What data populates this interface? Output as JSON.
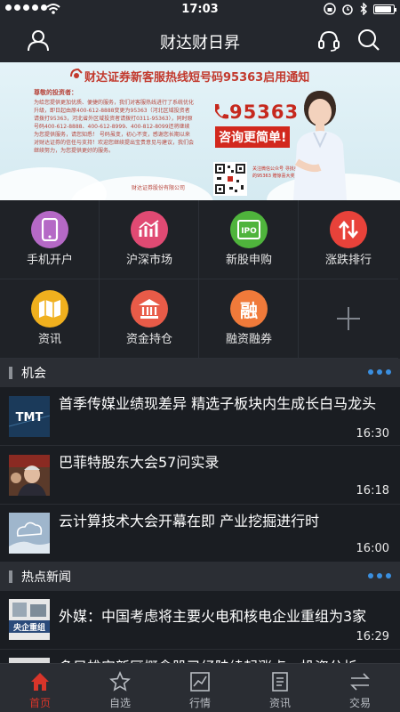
{
  "status_bar": {
    "time": "17:03",
    "battery_level": 0.9
  },
  "header": {
    "title": "财达财日昇"
  },
  "banner": {
    "headline": "财达证券新客服热线短号码95363启用通知",
    "letter_title": "尊敬的投资者：",
    "letter_body": "为给您提供更加优质、便捷的服务，我们对客服热线进行了系统优化升级，即日起由原400-612-8888变更为95363（河北区域投资者请拨打95363，河北省外区域投资者请拨打0311-95363），同时原号码400-612-8888、400-612-8999、400-812-8099还将继续为您提供服务，请您知悉！ 号码虽变，初心不变，感谢您长期以来对财达证券的信任与支持！欢迎您继续提出宝贵意见与建议，我们会继续努力，为您提供更好的服务。",
    "letter_sign": "财达证券股份有限公司",
    "phone": "95363",
    "tagline": "咨询更简单!",
    "qr_text": "关注微信公众号 寻找身边的95363 赠惊喜大奖！"
  },
  "grid": [
    {
      "label": "手机开户",
      "icon": "phone-icon",
      "color": "#b569c6"
    },
    {
      "label": "沪深市场",
      "icon": "market-chart-icon",
      "color": "#e04a73"
    },
    {
      "label": "新股申购",
      "icon": "ipo-icon",
      "color": "#4fb43c"
    },
    {
      "label": "涨跌排行",
      "icon": "up-down-arrows-icon",
      "color": "#e8423a"
    },
    {
      "label": "资讯",
      "icon": "map-icon",
      "color": "#f0b01e"
    },
    {
      "label": "资金持仓",
      "icon": "bank-icon",
      "color": "#e85b48"
    },
    {
      "label": "融资融券",
      "icon": "margin-icon",
      "color": "#f07a3a",
      "glyph": "融"
    }
  ],
  "sections": {
    "opportunity": {
      "name": "机会",
      "items": [
        {
          "title": "首季传媒业绩现差异 精选子板块内生成长白马龙头",
          "time": "16:30",
          "thumb": "tmt-thumb",
          "thumb_text": "TMT"
        },
        {
          "title": "巴菲特股东大会57问实录",
          "time": "16:18",
          "thumb": "buffett-thumb"
        },
        {
          "title": "云计算技术大会开幕在即 产业挖掘进行时",
          "time": "16:00",
          "thumb": "cloud-thumb"
        }
      ]
    },
    "hot_news": {
      "name": "热点新闻",
      "items": [
        {
          "title": "外媒：中国考虑将主要火电和核电企业重组为3家",
          "time": "16:29",
          "thumb": "soe-restructure-thumb",
          "thumb_text": "央企重组"
        },
        {
          "title": "多只雄安新区概念股已经陆续起涨点，投资分析",
          "time": "",
          "thumb": "xiongan-thumb"
        }
      ]
    }
  },
  "tab_bar": [
    {
      "label": "首页",
      "icon": "home-icon",
      "active": true
    },
    {
      "label": "自选",
      "icon": "star-icon",
      "active": false
    },
    {
      "label": "行情",
      "icon": "quote-chart-icon",
      "active": false
    },
    {
      "label": "资讯",
      "icon": "document-icon",
      "active": false
    },
    {
      "label": "交易",
      "icon": "trade-arrows-icon",
      "active": false
    }
  ],
  "colors": {
    "accent": "#d8352a",
    "more_dots": "#3a8fe0"
  }
}
